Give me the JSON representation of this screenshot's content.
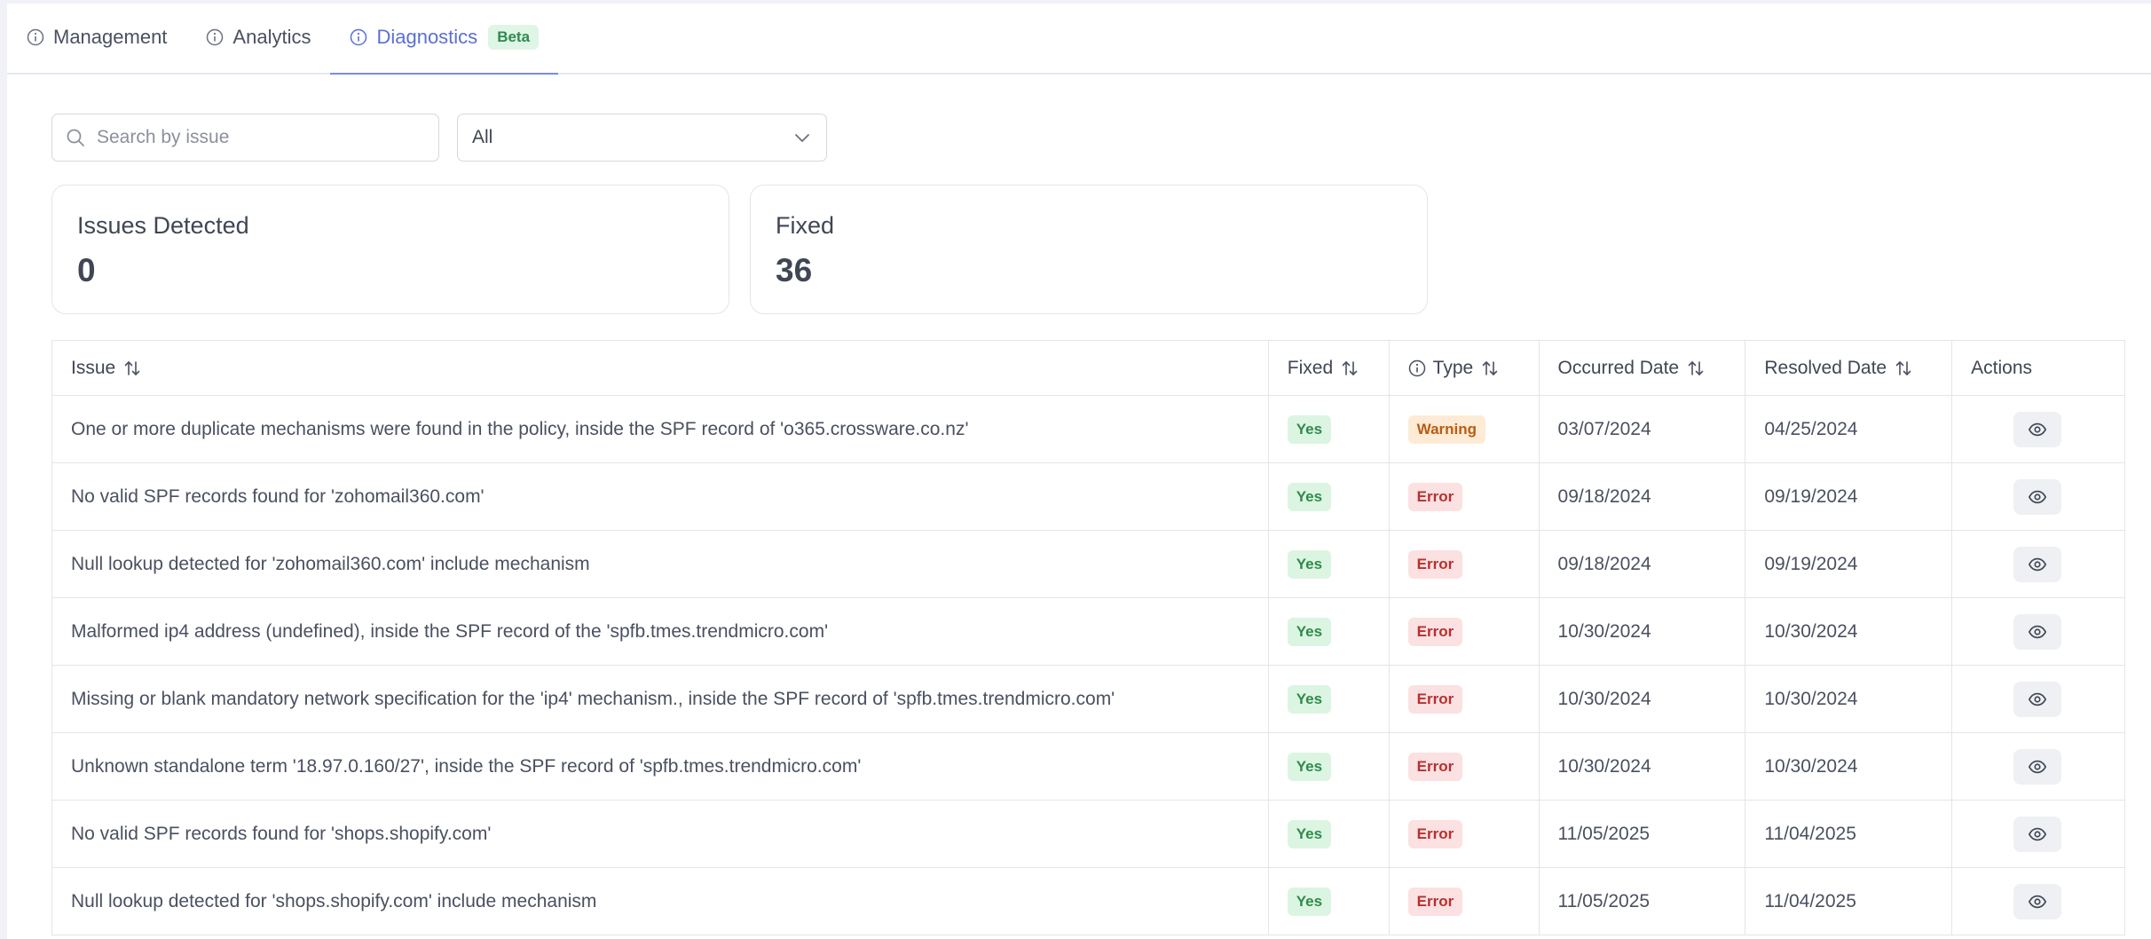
{
  "tabs": [
    {
      "label": "Management",
      "icon": "info-icon"
    },
    {
      "label": "Analytics",
      "icon": "info-icon"
    },
    {
      "label": "Diagnostics",
      "icon": "info-icon",
      "badge": "Beta",
      "active": true
    }
  ],
  "filters": {
    "search_placeholder": "Search by issue",
    "select_value": "All"
  },
  "stats": {
    "issues_detected": {
      "label": "Issues Detected",
      "value": "0"
    },
    "fixed": {
      "label": "Fixed",
      "value": "36"
    }
  },
  "table": {
    "headers": {
      "issue": "Issue",
      "fixed": "Fixed",
      "type": "Type",
      "occurred": "Occurred Date",
      "resolved": "Resolved Date",
      "actions": "Actions"
    },
    "rows": [
      {
        "issue": "One or more duplicate mechanisms were found in the policy, inside the SPF record of 'o365.crossware.co.nz'",
        "fixed": "Yes",
        "type": "Warning",
        "occurred": "03/07/2024",
        "resolved": "04/25/2024"
      },
      {
        "issue": "No valid SPF records found for 'zohomail360.com'",
        "fixed": "Yes",
        "type": "Error",
        "occurred": "09/18/2024",
        "resolved": "09/19/2024"
      },
      {
        "issue": "Null lookup detected for 'zohomail360.com' include mechanism",
        "fixed": "Yes",
        "type": "Error",
        "occurred": "09/18/2024",
        "resolved": "09/19/2024"
      },
      {
        "issue": "Malformed ip4 address (undefined), inside the SPF record of the 'spfb.tmes.trendmicro.com'",
        "fixed": "Yes",
        "type": "Error",
        "occurred": "10/30/2024",
        "resolved": "10/30/2024"
      },
      {
        "issue": "Missing or blank mandatory network specification for the 'ip4' mechanism., inside the SPF record of 'spfb.tmes.trendmicro.com'",
        "fixed": "Yes",
        "type": "Error",
        "occurred": "10/30/2024",
        "resolved": "10/30/2024"
      },
      {
        "issue": "Unknown standalone term '18.97.0.160/27', inside the SPF record of 'spfb.tmes.trendmicro.com'",
        "fixed": "Yes",
        "type": "Error",
        "occurred": "10/30/2024",
        "resolved": "10/30/2024"
      },
      {
        "issue": "No valid SPF records found for 'shops.shopify.com'",
        "fixed": "Yes",
        "type": "Error",
        "occurred": "11/05/2025",
        "resolved": "11/04/2025"
      },
      {
        "issue": "Null lookup detected for 'shops.shopify.com' include mechanism",
        "fixed": "Yes",
        "type": "Error",
        "occurred": "11/05/2025",
        "resolved": "11/04/2025"
      }
    ]
  },
  "colors": {
    "accent": "#5b6fd6",
    "yes_bg": "#dcf5e2",
    "warning_bg": "#fdebd6",
    "error_bg": "#fbe1e1"
  }
}
